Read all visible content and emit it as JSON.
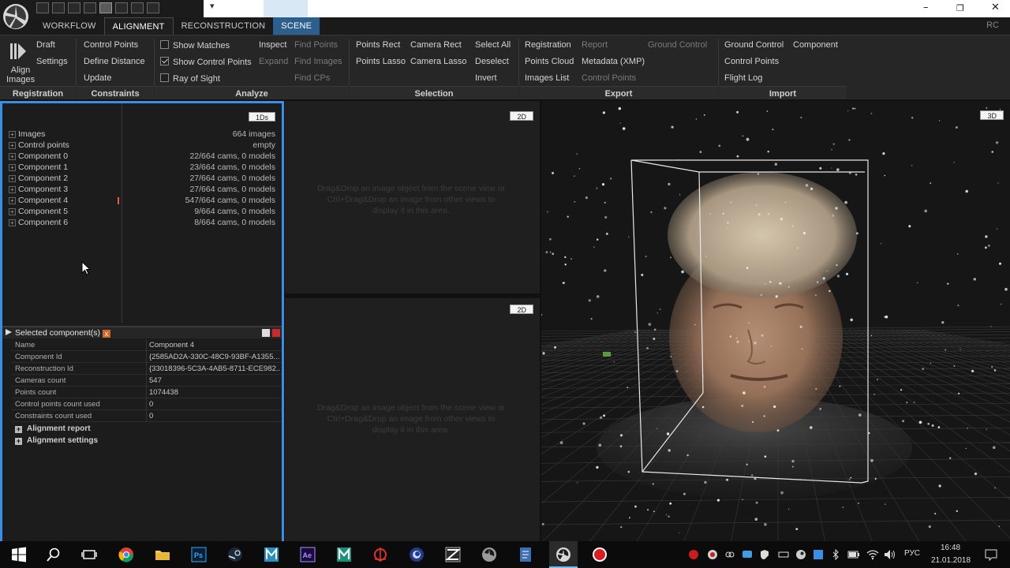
{
  "menu": {
    "tabs": [
      "WORKFLOW",
      "ALIGNMENT",
      "RECONSTRUCTION",
      "SCENE"
    ],
    "rc_label": "RC"
  },
  "ribbon": {
    "registration": {
      "title": "Registration",
      "align_images": "Align\nImages",
      "draft": "Draft",
      "settings": "Settings"
    },
    "constraints": {
      "title": "Constraints",
      "control_points": "Control Points",
      "define_distance": "Define Distance",
      "update": "Update"
    },
    "analyze": {
      "title": "Analyze",
      "show_matches": "Show Matches",
      "show_control_points": "Show Control Points",
      "ray_of_sight": "Ray of Sight",
      "inspect": "Inspect",
      "expand": "Expand",
      "find_points": "Find Points",
      "find_images": "Find Images",
      "find_cps": "Find CPs"
    },
    "selection": {
      "title": "Selection",
      "points_rect": "Points Rect",
      "camera_rect": "Camera Rect",
      "points_lasso": "Points Lasso",
      "camera_lasso": "Camera Lasso",
      "select_all": "Select All",
      "deselect": "Deselect",
      "invert": "Invert"
    },
    "export": {
      "title": "Export",
      "registration": "Registration",
      "points_cloud": "Points Cloud",
      "images_list": "Images List",
      "report": "Report",
      "metadata": "Metadata (XMP)",
      "control_points": "Control Points",
      "ground_control": "Ground Control"
    },
    "import": {
      "title": "Import",
      "ground_control": "Ground Control",
      "component": "Component",
      "control_points": "Control Points",
      "flight_log": "Flight Log"
    }
  },
  "tree": {
    "badge": "1Ds",
    "items": [
      {
        "label": "Images",
        "value": "664 images"
      },
      {
        "label": "Control points",
        "value": "empty"
      },
      {
        "label": "Component 0",
        "value": "22/664 cams, 0 models"
      },
      {
        "label": "Component 1",
        "value": "23/664 cams, 0 models"
      },
      {
        "label": "Component 2",
        "value": "27/664 cams, 0 models"
      },
      {
        "label": "Component 3",
        "value": "27/664 cams, 0 models"
      },
      {
        "label": "Component 4",
        "value": "547/664 cams, 0 models"
      },
      {
        "label": "Component 5",
        "value": "9/664 cams, 0 models"
      },
      {
        "label": "Component 6",
        "value": "8/664 cams, 0 models"
      }
    ]
  },
  "selected": {
    "title": "Selected component(s)",
    "rows": [
      {
        "k": "Name",
        "v": "Component 4"
      },
      {
        "k": "Component Id",
        "v": "{2585AD2A-330C-48C9-93BF-A1355..."
      },
      {
        "k": "Reconstruction Id",
        "v": "{33018396-5C3A-4AB5-8711-ECE982..."
      },
      {
        "k": "Cameras count",
        "v": "547"
      },
      {
        "k": "Points count",
        "v": "1074438"
      },
      {
        "k": "Control points count used",
        "v": "0"
      },
      {
        "k": "Constraints count used",
        "v": "0"
      }
    ],
    "sections": [
      "Alignment report",
      "Alignment settings"
    ]
  },
  "views": {
    "top_badge": "2D",
    "bottom_badge": "2D",
    "three_d_badge": "3D",
    "hint": "Drag&Drop an image object from the scene view or Ctrl+Drag&Drop an image from other views to display it in this area."
  },
  "taskbar": {
    "lang": "РУС",
    "time": "16:48",
    "date": "21.01.2018"
  }
}
